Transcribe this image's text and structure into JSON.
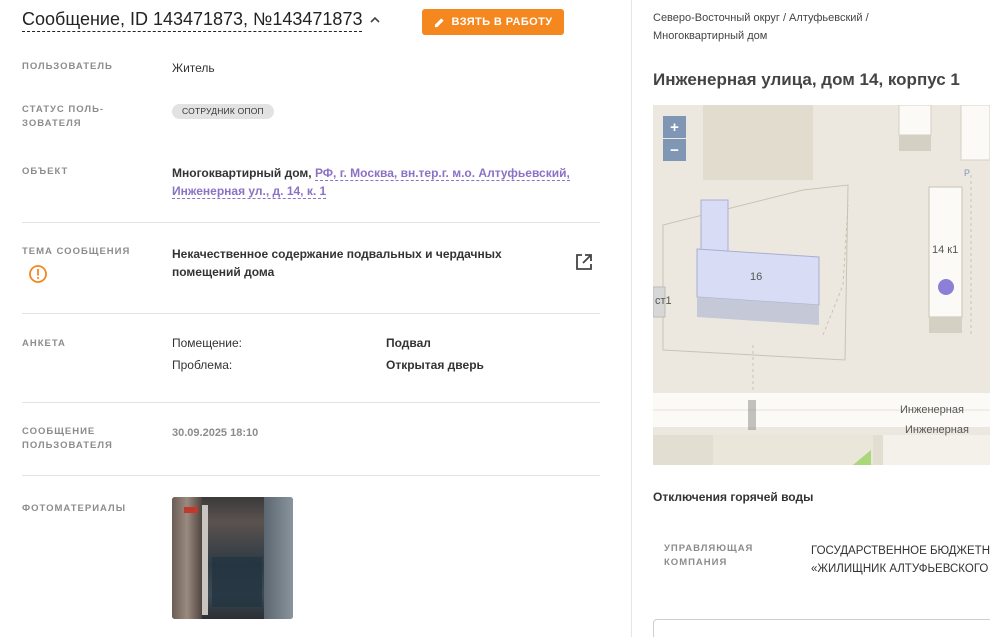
{
  "header": {
    "title": "Сообщение, ID 143471873, №143471873",
    "take_button": "ВЗЯТЬ В РАБОТУ"
  },
  "fields": {
    "user_label": "ПОЛЬЗОВАТЕЛЬ",
    "user_value": "Житель",
    "status_label": "СТАТУС ПОЛЬ-ЗОВАТЕЛЯ",
    "status_label_line1": "СТАТУС ПОЛЬ-",
    "status_label_line2": "ЗОВАТЕЛЯ",
    "status_value": "СОТРУДНИК ОПОП",
    "object_label": "ОБЪЕКТ",
    "object_type": "Многоквартирный дом,",
    "object_link": "РФ, г. Москва, вн.тер.г. м.о. Алтуфьевский, Инженерная ул., д. 14, к. 1",
    "object_link_line1": "РФ, г. Москва, вн.тер.г. м.о. Алтуфьевский,",
    "object_link_line2": "Инженерная ул., д. 14, к. 1",
    "theme_label": "ТЕМА СООБЩЕНИЯ",
    "theme_value": "Некачественное содержание подвальных и чердачных помещений дома",
    "survey_label": "АНКЕТА",
    "survey": [
      {
        "key": "Помещение:",
        "value": "Подвал"
      },
      {
        "key": "Проблема:",
        "value": "Открытая дверь"
      }
    ],
    "user_message_label_line1": "СООБЩЕНИЕ",
    "user_message_label_line2": "ПОЛЬЗОВАТЕЛЯ",
    "user_message_value": "30.09.2025 18:10",
    "photos_label": "ФОТОМАТЕРИАЛЫ"
  },
  "right": {
    "breadcrumb_line1": "Северо-Восточный округ / Алтуфьевский /",
    "breadcrumb_line2": "Многоквартирный дом",
    "address": "Инженерная улица, дом 14, корпус 1",
    "map": {
      "zoom_in": "+",
      "zoom_out": "−",
      "building_16": "16",
      "building_14k1": "14 к1",
      "building_st1": "ст1",
      "parking": "P",
      "street_1": "Инженерная",
      "street_2": "Инженерная",
      "marker_color": "#8b7fd6"
    },
    "hot_water_title": "Отключения горячей воды",
    "mc_label_line1": "УПРАВЛЯЮЩАЯ",
    "mc_label_line2": "КОМПАНИЯ",
    "mc_value_line1": "ГОСУДАРСТВЕННОЕ БЮДЖЕТН",
    "mc_value_line2": "«ЖИЛИЩНИК АЛТУФЬЕВСКОГО"
  },
  "colors": {
    "accent": "#f5871f",
    "link": "#8b72c4",
    "zoom": "#7f97b5"
  }
}
